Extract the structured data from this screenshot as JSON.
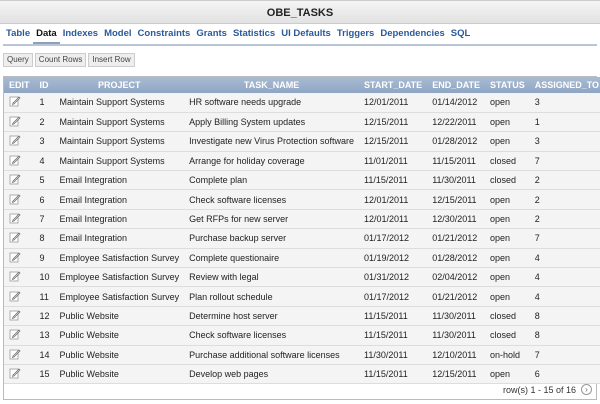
{
  "title": "OBE_TASKS",
  "tabs": [
    {
      "label": "Table"
    },
    {
      "label": "Data",
      "active": true
    },
    {
      "label": "Indexes"
    },
    {
      "label": "Model"
    },
    {
      "label": "Constraints"
    },
    {
      "label": "Grants"
    },
    {
      "label": "Statistics"
    },
    {
      "label": "UI Defaults"
    },
    {
      "label": "Triggers"
    },
    {
      "label": "Dependencies"
    },
    {
      "label": "SQL"
    }
  ],
  "buttons": {
    "query": "Query",
    "count_rows": "Count Rows",
    "insert_row": "Insert Row"
  },
  "columns": [
    "EDIT",
    "ID",
    "PROJECT",
    "TASK_NAME",
    "START_DATE",
    "END_DATE",
    "STATUS",
    "ASSIGNED_TO"
  ],
  "rows": [
    [
      "1",
      "Maintain Support Systems",
      "HR software needs upgrade",
      "12/01/2011",
      "01/14/2012",
      "open",
      "3"
    ],
    [
      "2",
      "Maintain Support Systems",
      "Apply Billing System updates",
      "12/15/2011",
      "12/22/2011",
      "open",
      "1"
    ],
    [
      "3",
      "Maintain Support Systems",
      "Investigate new Virus Protection software",
      "12/15/2011",
      "01/28/2012",
      "open",
      "3"
    ],
    [
      "4",
      "Maintain Support Systems",
      "Arrange for holiday coverage",
      "11/01/2011",
      "11/15/2011",
      "closed",
      "7"
    ],
    [
      "5",
      "Email Integration",
      "Complete plan",
      "11/15/2011",
      "11/30/2011",
      "closed",
      "2"
    ],
    [
      "6",
      "Email Integration",
      "Check software licenses",
      "12/01/2011",
      "12/15/2011",
      "open",
      "2"
    ],
    [
      "7",
      "Email Integration",
      "Get RFPs for new server",
      "12/01/2011",
      "12/30/2011",
      "open",
      "2"
    ],
    [
      "8",
      "Email Integration",
      "Purchase backup server",
      "01/17/2012",
      "01/21/2012",
      "open",
      "7"
    ],
    [
      "9",
      "Employee Satisfaction Survey",
      "Complete questionaire",
      "01/19/2012",
      "01/28/2012",
      "open",
      "4"
    ],
    [
      "10",
      "Employee Satisfaction Survey",
      "Review with legal",
      "01/31/2012",
      "02/04/2012",
      "open",
      "4"
    ],
    [
      "11",
      "Employee Satisfaction Survey",
      "Plan rollout schedule",
      "01/17/2012",
      "01/21/2012",
      "open",
      "4"
    ],
    [
      "12",
      "Public Website",
      "Determine host server",
      "11/15/2011",
      "11/30/2011",
      "closed",
      "8"
    ],
    [
      "13",
      "Public Website",
      "Check software licenses",
      "11/15/2011",
      "11/30/2011",
      "closed",
      "8"
    ],
    [
      "14",
      "Public Website",
      "Purchase additional software licenses",
      "11/30/2011",
      "12/10/2011",
      "on-hold",
      "7"
    ],
    [
      "15",
      "Public Website",
      "Develop web pages",
      "11/15/2011",
      "12/15/2011",
      "open",
      "6"
    ]
  ],
  "pagination": {
    "text": "row(s) 1 - 15 of 16",
    "next_icon": "chevron-right-circle-icon"
  },
  "colors": {
    "header": "#98aecb",
    "link": "#2a5a9a"
  }
}
